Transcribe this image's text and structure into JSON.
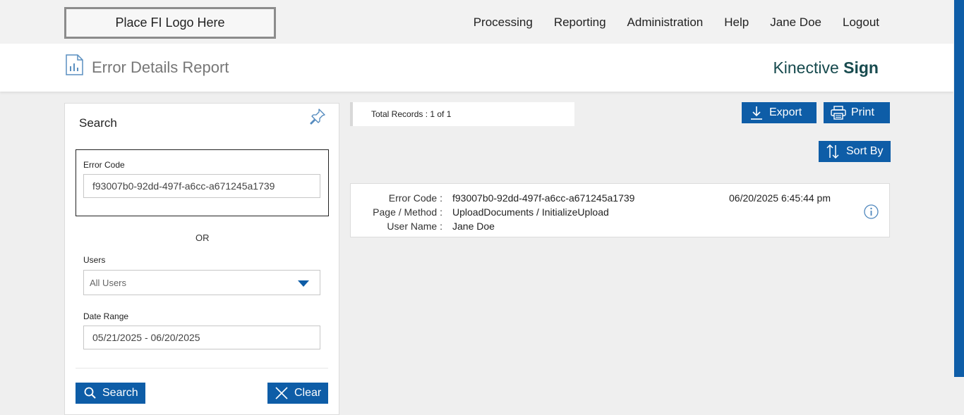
{
  "header": {
    "logo_placeholder": "Place FI Logo Here",
    "nav": [
      "Processing",
      "Reporting",
      "Administration",
      "Help",
      "Jane Doe",
      "Logout"
    ]
  },
  "title_bar": {
    "title": "Error Details Report",
    "brand_light": "Kinective ",
    "brand_bold": "Sign",
    "icon": "bar-chart-document-icon"
  },
  "search_panel": {
    "title": "Search",
    "error_code_label": "Error Code",
    "error_code_value": "f93007b0-92dd-497f-a6cc-a671245a1739",
    "or_label": "OR",
    "users_label": "Users",
    "users_selected": "All Users",
    "date_range_label": "Date Range",
    "date_range_value": "05/21/2025 - 06/20/2025",
    "search_button": "Search",
    "clear_button": "Clear"
  },
  "results": {
    "total_records": "Total Records : 1 of 1",
    "export_button": "Export",
    "print_button": "Print",
    "sort_button": "Sort By",
    "items": [
      {
        "error_code_label": "Error Code :",
        "error_code": "f93007b0-92dd-497f-a6cc-a671245a1739",
        "page_method_label": "Page / Method :",
        "page_method": "UploadDocuments / InitializeUpload",
        "user_name_label": "User Name :",
        "user_name": "Jane Doe",
        "timestamp": "06/20/2025 6:45:44 pm"
      }
    ]
  },
  "colors": {
    "accent": "#0e5da7",
    "brand": "#174a4e",
    "page_bg": "#efefef"
  }
}
